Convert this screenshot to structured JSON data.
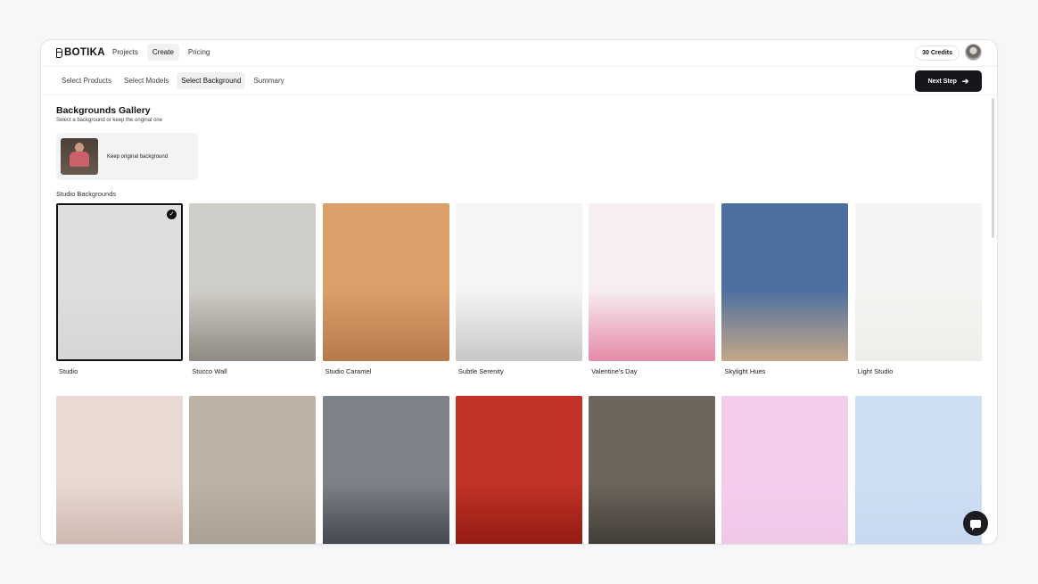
{
  "app": {
    "brand": "BOTIKA"
  },
  "nav": {
    "items": [
      "Projects",
      "Create",
      "Pricing"
    ],
    "active": "Create"
  },
  "account": {
    "credits": "30 Credits"
  },
  "steps": {
    "items": [
      "Select Products",
      "Select Models",
      "Select Background",
      "Summary"
    ],
    "active": "Select Background"
  },
  "actions": {
    "next_label": "Next Step"
  },
  "gallery": {
    "title": "Backgrounds Gallery",
    "subtitle": "Select a background or keep the original one",
    "keep_original_label": "Keep original background",
    "section_label": "Studio Backgrounds"
  },
  "backgrounds": [
    {
      "label": "Studio",
      "selected": true,
      "colors": [
        "#dedddf",
        "#d6d5d7"
      ]
    },
    {
      "label": "Stucco Wall",
      "selected": false,
      "colors": [
        "#cfcdc7",
        "#8f8a82"
      ]
    },
    {
      "label": "Studio Caramel",
      "selected": false,
      "colors": [
        "#d9a06a",
        "#b57a4a"
      ]
    },
    {
      "label": "Subtle Serenity",
      "selected": false,
      "colors": [
        "#f4f5f6",
        "#c7c8c9"
      ]
    },
    {
      "label": "Valentine's Day",
      "selected": false,
      "colors": [
        "#f6eef0",
        "#e58aa6"
      ]
    },
    {
      "label": "Skylight Hues",
      "selected": false,
      "colors": [
        "#4d6fa0",
        "#c4a888"
      ]
    },
    {
      "label": "Light Studio",
      "selected": false,
      "colors": [
        "#f5f4f2",
        "#efeeeb"
      ]
    },
    {
      "label": "",
      "selected": false,
      "colors": [
        "#e9d9d2",
        "#c9b5ac"
      ]
    },
    {
      "label": "",
      "selected": false,
      "colors": [
        "#bdb2a4",
        "#a89d90"
      ]
    },
    {
      "label": "",
      "selected": false,
      "colors": [
        "#7d8288",
        "#3b4049"
      ]
    },
    {
      "label": "",
      "selected": false,
      "colors": [
        "#c23228",
        "#8d1810"
      ]
    },
    {
      "label": "",
      "selected": false,
      "colors": [
        "#6d665d",
        "#3b3731"
      ]
    },
    {
      "label": "",
      "selected": false,
      "colors": [
        "#f2cdec",
        "#efc8e8"
      ]
    },
    {
      "label": "",
      "selected": false,
      "colors": [
        "#cddff3",
        "#c6d8ee"
      ]
    }
  ]
}
